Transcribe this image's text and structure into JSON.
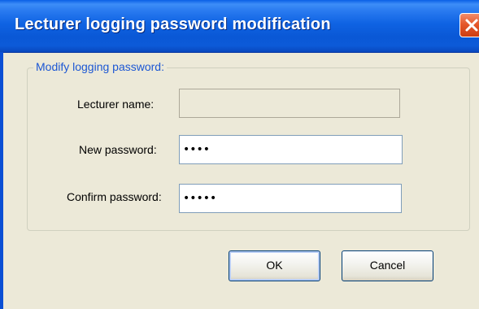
{
  "window": {
    "title": "Lecturer logging password modification"
  },
  "titlebar": {
    "close_icon": "close-icon"
  },
  "group": {
    "legend": "Modify logging password:"
  },
  "fields": {
    "lecturer_name": {
      "label": "Lecturer name:",
      "value": ""
    },
    "new_password": {
      "label": "New password:",
      "value": "••••"
    },
    "confirm_password": {
      "label": "Confirm password:",
      "value": "•••••"
    }
  },
  "buttons": {
    "ok_label": "OK",
    "cancel_label": "Cancel"
  },
  "colors": {
    "titlebar_blue": "#0a58d6",
    "dialog_background": "#ece9d8",
    "groupbox_legend": "#1c57d4",
    "close_red": "#e5582b"
  }
}
